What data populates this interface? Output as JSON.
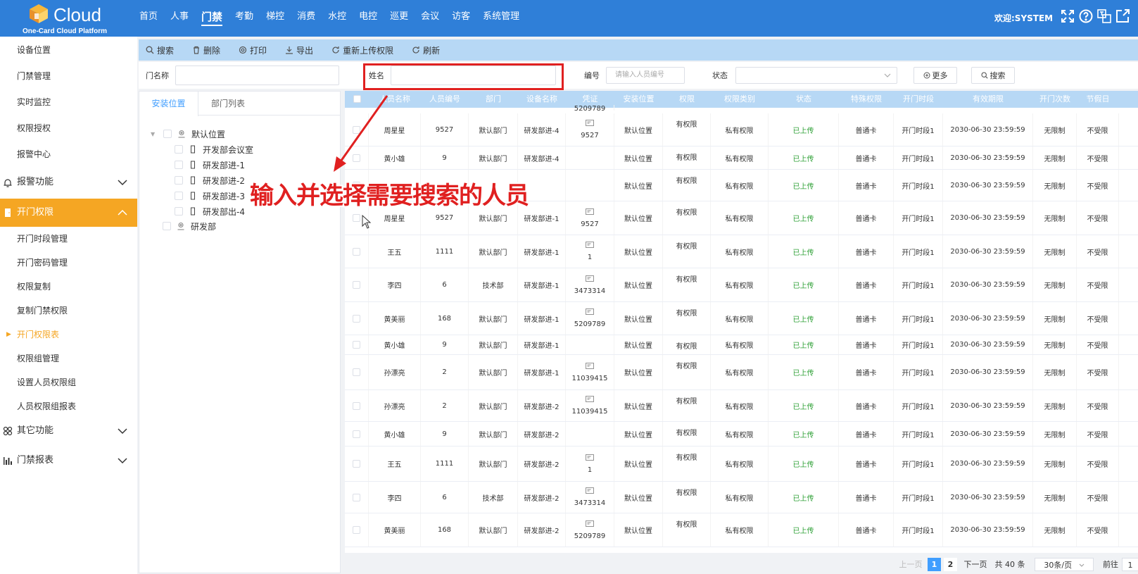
{
  "header": {
    "logo_text": "Cloud",
    "logo_sub": "One-Card Cloud Platform",
    "nav": [
      "首页",
      "人事",
      "门禁",
      "考勤",
      "梯控",
      "消费",
      "水控",
      "电控",
      "巡更",
      "会议",
      "访客",
      "系统管理"
    ],
    "active_nav": "门禁",
    "welcome": "欢迎:SYSTEM",
    "colors": {
      "header_bg": "#2f7fd8",
      "accent": "#f5a623",
      "link": "#409eff",
      "uploaded": "#2ea036",
      "annotation": "#e02020"
    }
  },
  "sidebar": {
    "top_items": [
      "设备位置",
      "门禁管理",
      "实时监控",
      "权限授权",
      "报警中心"
    ],
    "group_alarm": "报警功能",
    "group_permission": "开门权限",
    "permission_items": [
      "开门时段管理",
      "开门密码管理",
      "权限复制",
      "复制门禁权限",
      "开门权限表",
      "权限组管理",
      "设置人员权限组",
      "人员权限组报表"
    ],
    "current_item": "开门权限表",
    "group_other": "其它功能",
    "group_report": "门禁报表"
  },
  "toolbar": {
    "search": "搜索",
    "delete": "删除",
    "print": "打印",
    "export": "导出",
    "reupload": "重新上传权限",
    "refresh": "刷新"
  },
  "filter": {
    "door_name_label": "门名称",
    "name_label": "姓名",
    "code_label": "编号",
    "code_placeholder": "请输入人员编号",
    "status_label": "状态",
    "more": "更多",
    "search": "搜索"
  },
  "tree": {
    "tabs": [
      "安装位置",
      "部门列表"
    ],
    "root": "默认位置",
    "children": [
      "开发部会议室",
      "研发部进-1",
      "研发部进-2",
      "研发部进-3",
      "研发部出-4"
    ],
    "root2": "研发部"
  },
  "table": {
    "columns": [
      "人员名称",
      "人员编号",
      "部门",
      "设备名称",
      "凭证",
      "安装位置",
      "权限",
      "权限类别",
      "状态",
      "特殊权限",
      "开门时段",
      "有效期限",
      "开门次数",
      "节假日"
    ],
    "top_partial_credential": "5209789",
    "rows": [
      {
        "name": "周星星",
        "no": "9527",
        "dept": "默认部门",
        "device": "研发部进-4",
        "cred": "9527",
        "loc": "默认位置",
        "perm": "有权限",
        "type": "私有权限",
        "status": "已上传",
        "special": "普通卡",
        "period": "开门时段1",
        "valid": "2030-06-30 23:59:59",
        "count": "无限制",
        "holiday": "不受限"
      },
      {
        "name": "黄小雄",
        "no": "9",
        "dept": "默认部门",
        "device": "研发部进-4",
        "cred": "",
        "loc": "默认位置",
        "perm": "有权限",
        "type": "私有权限",
        "status": "已上传",
        "special": "普通卡",
        "period": "开门时段1",
        "valid": "2030-06-30 23:59:59",
        "count": "无限制",
        "holiday": "不受限"
      },
      {
        "name": "",
        "no": "",
        "dept": "",
        "device": "",
        "cred": "",
        "loc": "默认位置",
        "perm": "有权限",
        "type": "私有权限",
        "status": "已上传",
        "special": "普通卡",
        "period": "开门时段1",
        "valid": "2030-06-30 23:59:59",
        "count": "无限制",
        "holiday": "不受限"
      },
      {
        "name": "周星星",
        "no": "9527",
        "dept": "默认部门",
        "device": "研发部进-1",
        "cred": "9527",
        "loc": "默认位置",
        "perm": "有权限",
        "type": "私有权限",
        "status": "已上传",
        "special": "普通卡",
        "period": "开门时段1",
        "valid": "2030-06-30 23:59:59",
        "count": "无限制",
        "holiday": "不受限"
      },
      {
        "name": "王五",
        "no": "1111",
        "dept": "默认部门",
        "device": "研发部进-1",
        "cred": "1",
        "loc": "默认位置",
        "perm": "有权限",
        "type": "私有权限",
        "status": "已上传",
        "special": "普通卡",
        "period": "开门时段1",
        "valid": "2030-06-30 23:59:59",
        "count": "无限制",
        "holiday": "不受限"
      },
      {
        "name": "李四",
        "no": "6",
        "dept": "技术部",
        "device": "研发部进-1",
        "cred": "3473314",
        "loc": "默认位置",
        "perm": "有权限",
        "type": "私有权限",
        "status": "已上传",
        "special": "普通卡",
        "period": "开门时段1",
        "valid": "2030-06-30 23:59:59",
        "count": "无限制",
        "holiday": "不受限"
      },
      {
        "name": "黄美丽",
        "no": "168",
        "dept": "默认部门",
        "device": "研发部进-1",
        "cred": "5209789",
        "loc": "默认位置",
        "perm": "有权限",
        "type": "私有权限",
        "status": "已上传",
        "special": "普通卡",
        "period": "开门时段1",
        "valid": "2030-06-30 23:59:59",
        "count": "无限制",
        "holiday": "不受限"
      },
      {
        "name": "黄小雄",
        "no": "9",
        "dept": "默认部门",
        "device": "研发部进-1",
        "cred": "",
        "loc": "默认位置",
        "perm": "有权限",
        "type": "私有权限",
        "status": "已上传",
        "special": "普通卡",
        "period": "开门时段1",
        "valid": "2030-06-30 23:59:59",
        "count": "无限制",
        "holiday": "不受限"
      },
      {
        "name": "孙漂亮",
        "no": "2",
        "dept": "默认部门",
        "device": "研发部进-1",
        "cred": "11039415",
        "loc": "默认位置",
        "perm": "有权限",
        "type": "私有权限",
        "status": "已上传",
        "special": "普通卡",
        "period": "开门时段1",
        "valid": "2030-06-30 23:59:59",
        "count": "无限制",
        "holiday": "不受限"
      },
      {
        "name": "孙漂亮",
        "no": "2",
        "dept": "默认部门",
        "device": "研发部进-2",
        "cred": "11039415",
        "loc": "默认位置",
        "perm": "有权限",
        "type": "私有权限",
        "status": "已上传",
        "special": "普通卡",
        "period": "开门时段1",
        "valid": "2030-06-30 23:59:59",
        "count": "无限制",
        "holiday": "不受限"
      },
      {
        "name": "黄小雄",
        "no": "9",
        "dept": "默认部门",
        "device": "研发部进-2",
        "cred": "",
        "loc": "默认位置",
        "perm": "有权限",
        "type": "私有权限",
        "status": "已上传",
        "special": "普通卡",
        "period": "开门时段1",
        "valid": "2030-06-30 23:59:59",
        "count": "无限制",
        "holiday": "不受限"
      },
      {
        "name": "王五",
        "no": "1111",
        "dept": "默认部门",
        "device": "研发部进-2",
        "cred": "1",
        "loc": "默认位置",
        "perm": "有权限",
        "type": "私有权限",
        "status": "已上传",
        "special": "普通卡",
        "period": "开门时段1",
        "valid": "2030-06-30 23:59:59",
        "count": "无限制",
        "holiday": "不受限"
      },
      {
        "name": "李四",
        "no": "6",
        "dept": "技术部",
        "device": "研发部进-2",
        "cred": "3473314",
        "loc": "默认位置",
        "perm": "有权限",
        "type": "私有权限",
        "status": "已上传",
        "special": "普通卡",
        "period": "开门时段1",
        "valid": "2030-06-30 23:59:59",
        "count": "无限制",
        "holiday": "不受限"
      },
      {
        "name": "黄美丽",
        "no": "168",
        "dept": "默认部门",
        "device": "研发部进-2",
        "cred": "5209789",
        "loc": "默认位置",
        "perm": "有权限",
        "type": "私有权限",
        "status": "已上传",
        "special": "普通卡",
        "period": "开门时段1",
        "valid": "2030-06-30 23:59:59",
        "count": "无限制",
        "holiday": "不受限"
      }
    ]
  },
  "pager": {
    "prev": "上一页",
    "pages": [
      "1",
      "2"
    ],
    "current": "1",
    "next": "下一页",
    "total": "共 40 条",
    "page_size": "30条/页",
    "goto": "前往",
    "goto_value": "1"
  },
  "annotation": "输入并选择需要搜索的人员"
}
